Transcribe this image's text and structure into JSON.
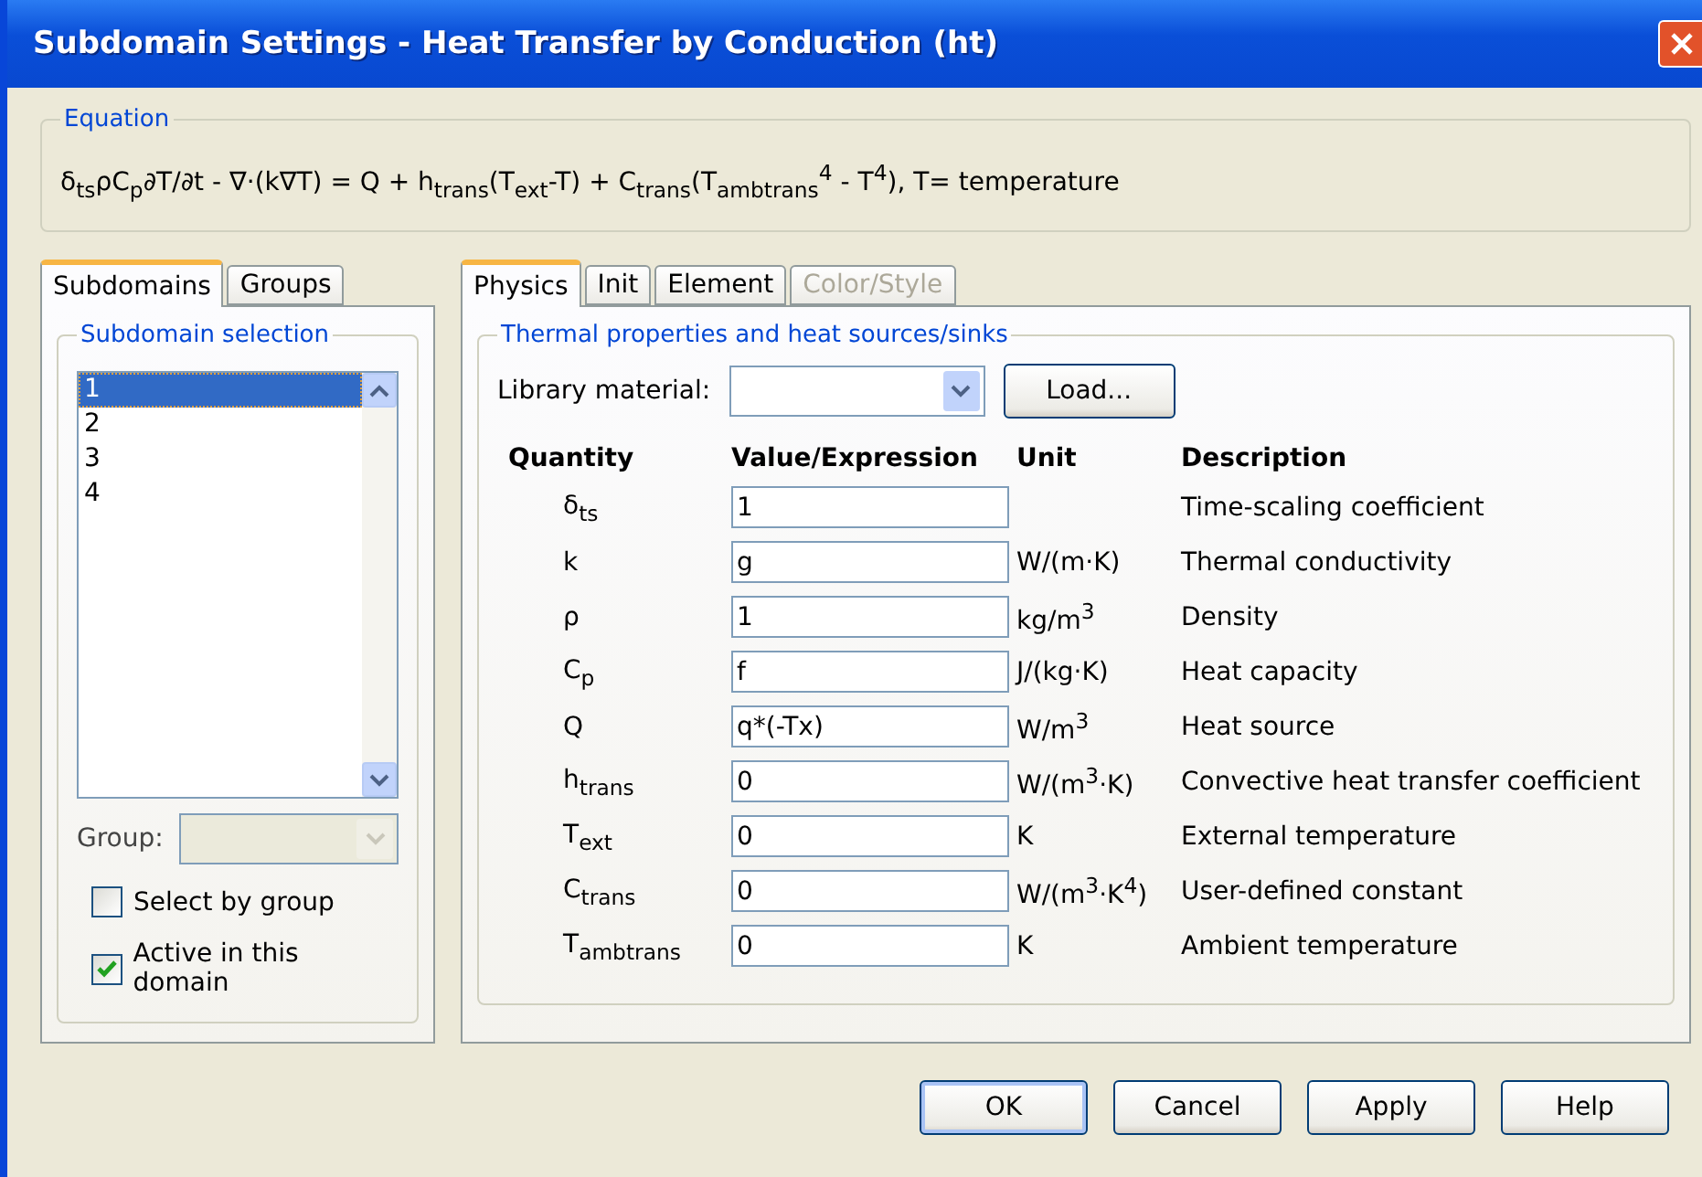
{
  "window": {
    "title": "Subdomain Settings - Heat Transfer by Conduction (ht)"
  },
  "equation": {
    "label": "Equation",
    "text": "δ$_{ts}$ρC$_{p}$∂T/∂t - ∇·(k∇T) = Q + h$_{trans}$(T$_{ext}$-T) + C$_{trans}$(T$_{ambtrans}$$^{4}$ - T$^{4}$), T= temperature"
  },
  "left_tabs": [
    {
      "label": "Subdomains",
      "selected": true
    },
    {
      "label": "Groups",
      "selected": false
    }
  ],
  "subdomain_selection": {
    "label": "Subdomain selection",
    "items": [
      {
        "label": "1",
        "selected": true
      },
      {
        "label": "2",
        "selected": false
      },
      {
        "label": "3",
        "selected": false
      },
      {
        "label": "4",
        "selected": false
      }
    ],
    "group": {
      "label": "Group:",
      "disabled": true
    },
    "checkboxes": [
      {
        "label": "Select by group",
        "checked": false
      },
      {
        "label": "Active in this domain",
        "checked": true
      }
    ]
  },
  "right_tabs": [
    {
      "label": "Physics",
      "selected": true,
      "disabled": false
    },
    {
      "label": "Init",
      "selected": false,
      "disabled": false
    },
    {
      "label": "Element",
      "selected": false,
      "disabled": false
    },
    {
      "label": "Color/Style",
      "selected": false,
      "disabled": true
    }
  ],
  "thermal": {
    "label": "Thermal properties and heat sources/sinks",
    "library_label": "Library material:",
    "load_button": "Load...",
    "columns": [
      "Quantity",
      "Value/Expression",
      "Unit",
      "Description"
    ],
    "rows": [
      {
        "quantity": "δ$_{ts}$",
        "value": "1",
        "unit": "",
        "description": "Time-scaling coefficient"
      },
      {
        "quantity": "k",
        "value": "g",
        "unit": "W/(m·K)",
        "description": "Thermal conductivity"
      },
      {
        "quantity": "ρ",
        "value": "1",
        "unit": "kg/m$^{3}$",
        "description": "Density"
      },
      {
        "quantity": "C$_{p}$",
        "value": "f",
        "unit": "J/(kg·K)",
        "description": "Heat capacity"
      },
      {
        "quantity": "Q",
        "value": "q*(-Tx)",
        "unit": "W/m$^{3}$",
        "description": "Heat source"
      },
      {
        "quantity": "h$_{trans}$",
        "value": "0",
        "unit": "W/(m$^{3}$·K)",
        "description": "Convective heat transfer coefficient"
      },
      {
        "quantity": "T$_{ext}$",
        "value": "0",
        "unit": "K",
        "description": "External temperature"
      },
      {
        "quantity": "C$_{trans}$",
        "value": "0",
        "unit": "W/(m$^{3}$·K$^{4}$)",
        "description": "User-defined constant"
      },
      {
        "quantity": "T$_{ambtrans}$",
        "value": "0",
        "unit": "K",
        "description": "Ambient temperature"
      }
    ]
  },
  "buttons": [
    {
      "label": "OK",
      "default": true
    },
    {
      "label": "Cancel",
      "default": false
    },
    {
      "label": "Apply",
      "default": false
    },
    {
      "label": "Help",
      "default": false
    }
  ]
}
